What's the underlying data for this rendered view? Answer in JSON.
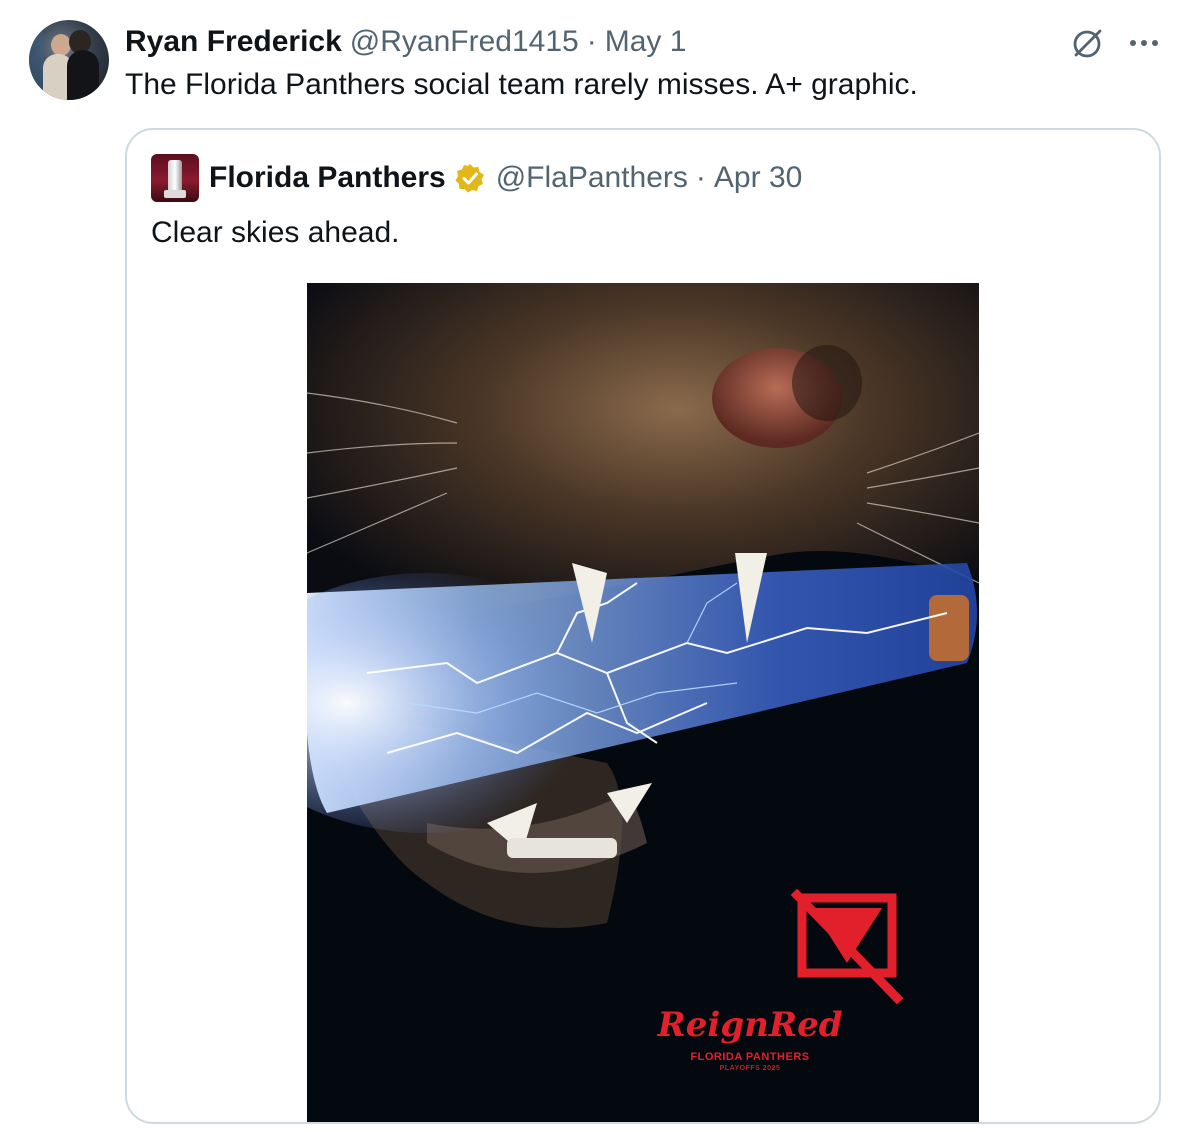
{
  "tweet": {
    "author_name": "Ryan Frederick",
    "author_handle": "@RyanFred1415",
    "separator": "·",
    "date": "May 1",
    "text": "The Florida Panthers social team rarely misses. A+ graphic.",
    "icons": {
      "grok": "grok-icon",
      "more": "more-icon"
    }
  },
  "quote": {
    "author_name": "Florida Panthers",
    "author_handle": "@FlaPanthers",
    "separator": "·",
    "date": "Apr 30",
    "verified_badge": "gold-verified-icon",
    "text": "Clear skies ahead.",
    "image": {
      "logo_title": "ReignRed",
      "logo_subtitle": "FLORIDA PANTHERS",
      "logo_subtitle_small": "PLAYOFFS 2025"
    }
  },
  "colors": {
    "text_primary": "#0f1419",
    "text_secondary": "#536471",
    "border": "#cfd9de",
    "verified_gold": "#e2b719",
    "logo_red": "#e2202c"
  }
}
